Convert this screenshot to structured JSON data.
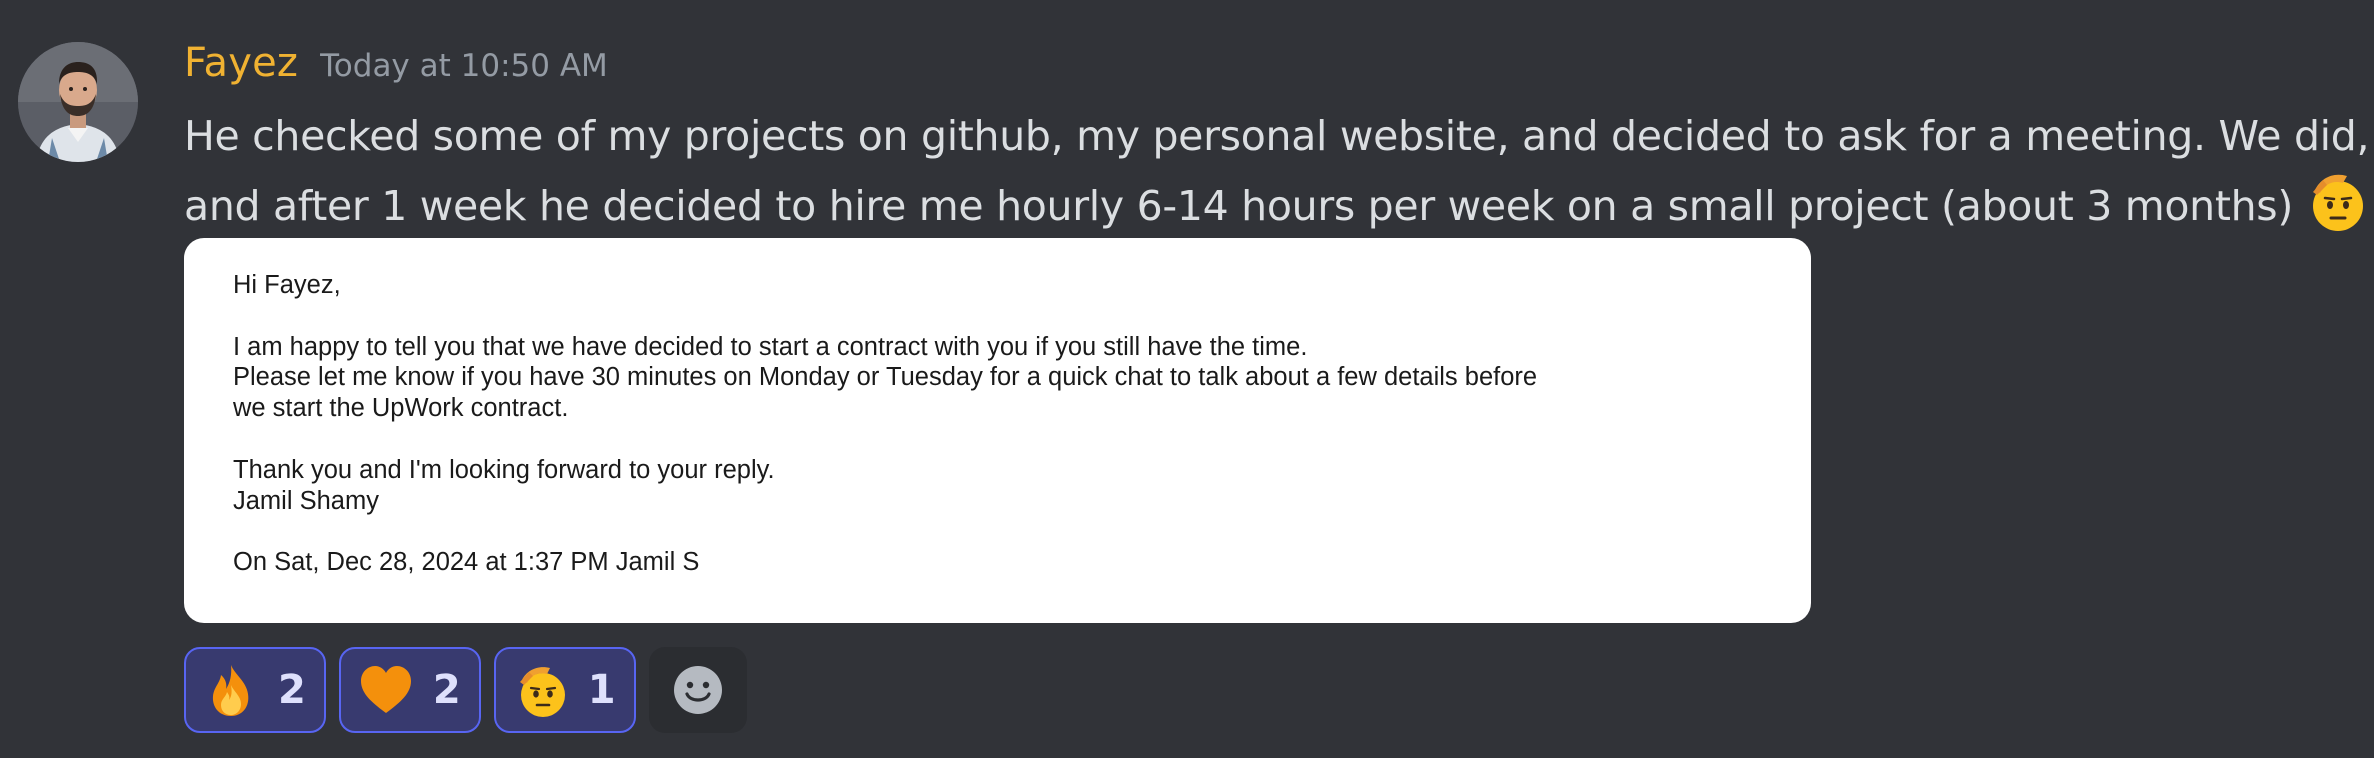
{
  "message": {
    "author": "Fayez",
    "timestamp": "Today at 10:50 AM",
    "author_color": "#f0b232",
    "lines": [
      "He checked some of my projects on github, my personal website, and decided to ask for a meeting. We did,",
      "and after 1 week he decided to hire me hourly 6-14 hours per week on a small project (about 3 months)"
    ],
    "trailing_emoji": "saluting-face-icon"
  },
  "attachment": {
    "greeting": "Hi Fayez,",
    "body_lines": [
      "I am happy to tell you that we have decided to start a contract with you if you still have the time.",
      "Please let me know if you have 30 minutes on Monday or Tuesday for a quick chat to talk about a few details before",
      "we start the UpWork contract."
    ],
    "closing": "Thank you and I'm looking forward to your reply.",
    "signature": "Jamil Shamy",
    "quote_header": "On Sat, Dec 28, 2024 at 1:37 PM Jamil S"
  },
  "reactions": [
    {
      "emoji": "fire-icon",
      "count": "2"
    },
    {
      "emoji": "orange-heart-icon",
      "count": "2"
    },
    {
      "emoji": "saluting-face-icon",
      "count": "1"
    }
  ],
  "add_reaction_icon": "add-reaction-smiley-icon",
  "colors": {
    "background": "#313338",
    "reaction_border": "#5865f2",
    "reaction_bg": "#383a6f"
  }
}
